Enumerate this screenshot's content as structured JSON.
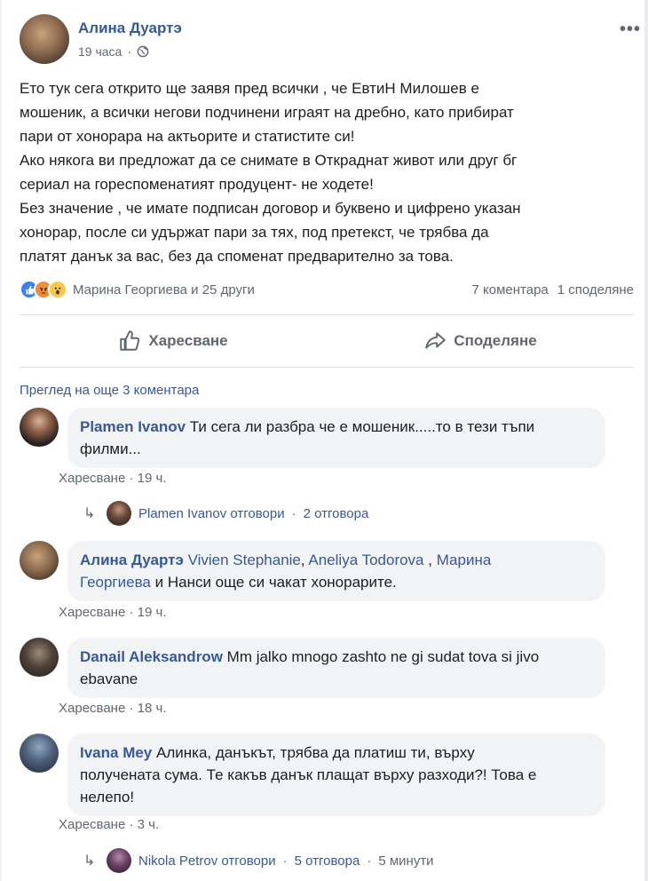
{
  "post": {
    "author": "Алина Дуартэ",
    "time": "19 часа",
    "more": "•••",
    "text": [
      "Ето тук сега открито ще заявя пред всички , че ЕвтиН Милошев е",
      "мошеник, а всички негови подчинени играят на дребно, като прибират",
      "пари от хонорара на актьорите и статистите си!",
      "Ако някога ви предложат да се снимате в Откраднат живот или друг бг",
      "сериал на гореспоменатият продуцент- не ходете!",
      "Без значение , че имате подписан договор и буквено и цифрено указан",
      "хонорар, после си удържат пари за тях, под претекст, че трябва да",
      "платят данък за вас, без да споменат предварително за това."
    ],
    "reactions_text": "Марина Георгиева и 25 други",
    "comments_count": "7 коментара",
    "shares_count": "1 споделяне",
    "like_label": "Харесване",
    "share_label": "Споделяне"
  },
  "view_more": "Преглед на още 3 коментара",
  "comments": [
    {
      "author": "Plamen Ivanov",
      "line1": "Ти сега ли разбра че е мошеник.....то в тези тъпи",
      "line2": "филми...",
      "like": "Харесване",
      "time": "19 ч."
    },
    {
      "author": "Алина Дуартэ",
      "tag1": "Vivien Stephanie",
      "sep1": ", ",
      "tag2": "Aneliya Todorova",
      "sep2": " , ",
      "tag3a": "Марина",
      "tag3b": "Георгиева",
      "rest": " и Нанси още си чакат хонорарите.",
      "like": "Харесване",
      "time": "19 ч."
    },
    {
      "author": "Danail Aleksandrow",
      "line1": "Mm jalko mnogo zashto ne gi sudat tova si jivo",
      "line2": "ebavane",
      "like": "Харесване",
      "time": "18 ч."
    },
    {
      "author": "Ivana Mey",
      "line1": "Алинка, данъкът, трябва да платиш ти, върху",
      "line2": "получената сума. Те какъв данък плащат върху разходи?! Това е",
      "line3": "нелепо!",
      "like": "Харесване",
      "time": "3 ч."
    }
  ],
  "replies": [
    {
      "text": "Plamen Ivanov отговори",
      "count": "2 отговора"
    },
    {
      "text": "Nikola Petrov отговори",
      "count": "5 отговора",
      "time": "5 минути"
    }
  ],
  "separator_dot": "·",
  "colors": {
    "link": "#385898",
    "muted": "#606770",
    "bubble": "#f2f3f5"
  }
}
